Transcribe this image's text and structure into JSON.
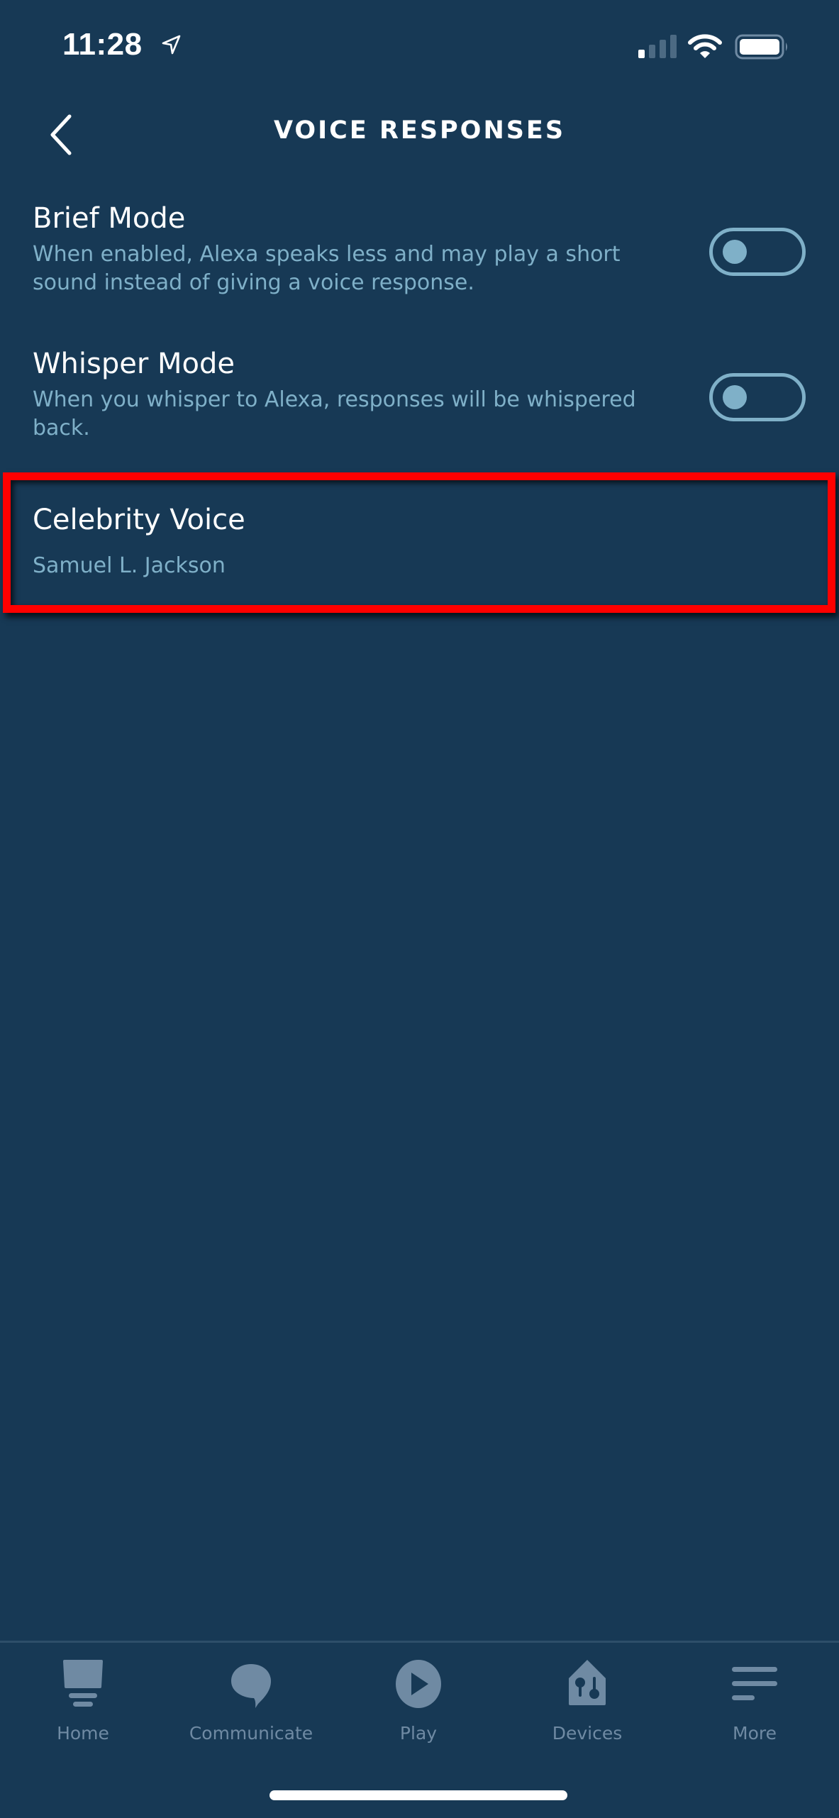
{
  "status_bar": {
    "time": "11:28",
    "location_icon": "location-arrow-icon",
    "signal_icon": "cellular-signal-icon",
    "signal_bars_active": 1,
    "signal_bars_total": 4,
    "wifi_icon": "wifi-icon",
    "battery_icon": "battery-icon",
    "battery_level": 1.0
  },
  "header": {
    "back_icon": "chevron-left-icon",
    "title": "VOICE RESPONSES"
  },
  "settings": [
    {
      "title": "Brief Mode",
      "description": "When enabled, Alexa speaks less and may play a short sound instead of giving a voice response.",
      "toggle_on": false
    },
    {
      "title": "Whisper Mode",
      "description": "When you whisper to Alexa, responses will be whispered back.",
      "toggle_on": false
    },
    {
      "title": "Celebrity Voice",
      "value": "Samuel L. Jackson",
      "highlighted": true
    }
  ],
  "bottom_nav": {
    "items": [
      {
        "label": "Home",
        "icon": "home-echo-icon"
      },
      {
        "label": "Communicate",
        "icon": "speech-bubble-icon"
      },
      {
        "label": "Play",
        "icon": "play-circle-icon"
      },
      {
        "label": "Devices",
        "icon": "devices-house-icon"
      },
      {
        "label": "More",
        "icon": "menu-lines-icon"
      }
    ]
  },
  "colors": {
    "background": "#173955",
    "secondary_text": "#7fb0c8",
    "nav_inactive": "#6f8aa3",
    "highlight": "#ff0000"
  }
}
